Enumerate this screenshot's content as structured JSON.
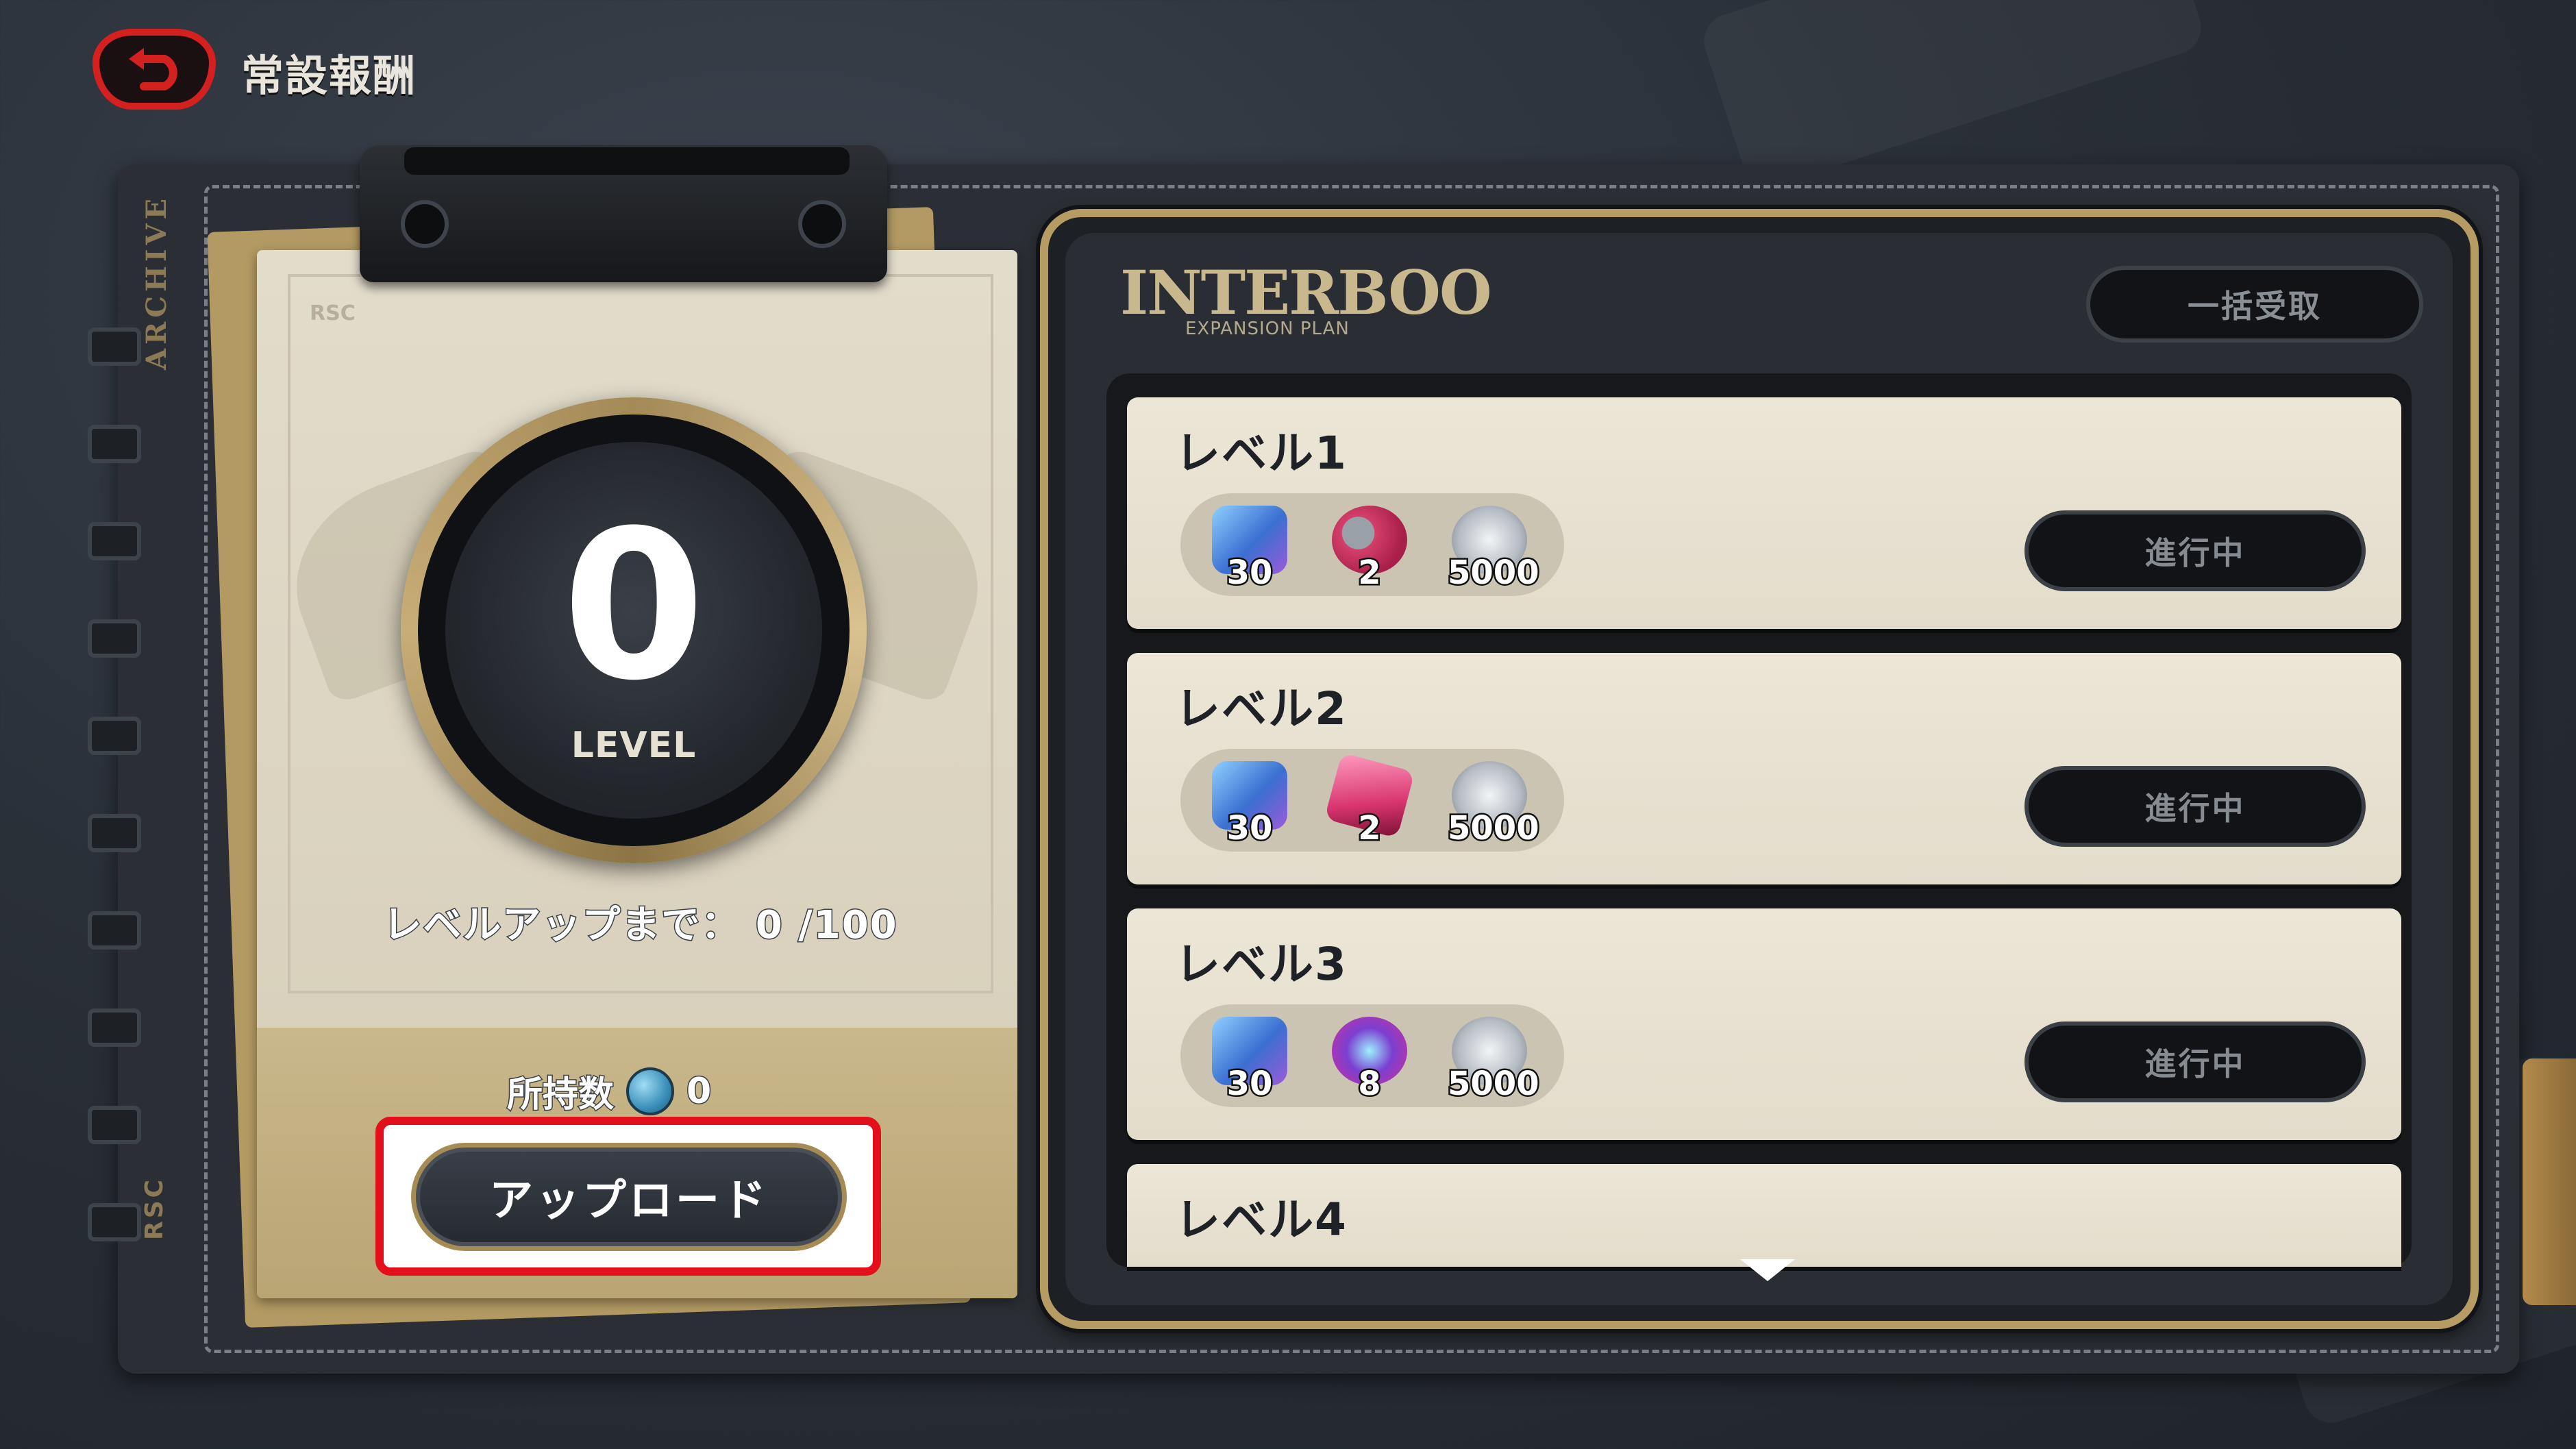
{
  "header": {
    "title": "常設報酬"
  },
  "left_panel": {
    "spine_label": "ARCHIVE",
    "spine_label_bottom": "RSC",
    "paper_mark": "RSC",
    "level_value": "0",
    "level_label": "LEVEL",
    "progress_text": "レベルアップまで： 0  /100",
    "owned_label": "所持数",
    "owned_value": "0",
    "upload_button": "アップロード"
  },
  "right_panel": {
    "brand": "INTERBOO",
    "brand_sub": "EXPANSION PLAN",
    "claim_all": "一括受取",
    "levels": [
      {
        "title": "レベル1",
        "status": "進行中",
        "rewards": [
          {
            "icon": "film-ticket-icon",
            "qty": "30"
          },
          {
            "icon": "tire-parts-icon",
            "qty": "2"
          },
          {
            "icon": "silver-coin-icon",
            "qty": "5000"
          }
        ]
      },
      {
        "title": "レベル2",
        "status": "進行中",
        "rewards": [
          {
            "icon": "film-ticket-icon",
            "qty": "30"
          },
          {
            "icon": "pink-chip-icon",
            "qty": "2"
          },
          {
            "icon": "silver-coin-icon",
            "qty": "5000"
          }
        ]
      },
      {
        "title": "レベル3",
        "status": "進行中",
        "rewards": [
          {
            "icon": "film-ticket-icon",
            "qty": "30"
          },
          {
            "icon": "gear-badge-icon",
            "qty": "8"
          },
          {
            "icon": "silver-coin-icon",
            "qty": "5000"
          }
        ]
      },
      {
        "title": "レベル4"
      }
    ]
  },
  "colors": {
    "accent_gold": "#b69c63",
    "highlight_red": "#e3101c",
    "back_red": "#d4201f"
  }
}
